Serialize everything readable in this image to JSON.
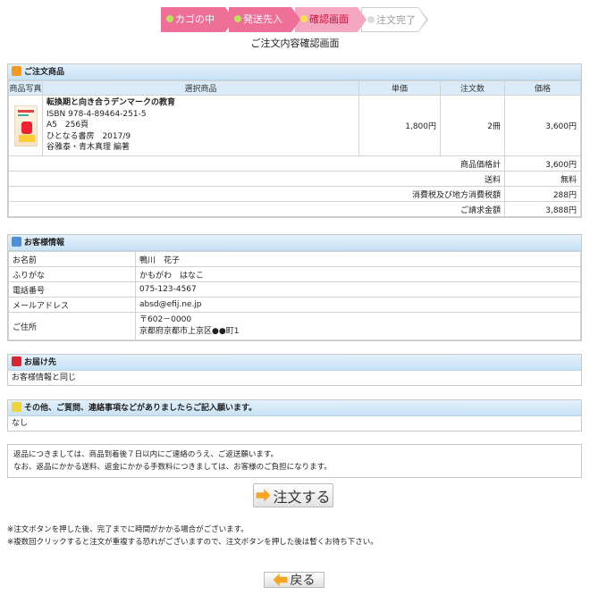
{
  "steps": [
    {
      "label": "カゴの中",
      "state": "done"
    },
    {
      "label": "発送先入力",
      "state": "done"
    },
    {
      "label": "確認画面",
      "state": "current"
    },
    {
      "label": "注文完了",
      "state": "todo"
    }
  ],
  "page_title": "ご注文内容確認画面",
  "order": {
    "section_title": "ご注文商品",
    "headers": {
      "photo": "商品写真",
      "item": "選択商品",
      "price": "単価",
      "qty": "注文数",
      "total": "価格"
    },
    "item": {
      "title": "転換期と向き合うデンマークの教育",
      "isbn": "ISBN 978-4-89464-251-5",
      "format": "A5　256頁",
      "publisher": "ひとなる書房　2017/9",
      "authors": "谷雅泰・青木真理 編著",
      "unit_price": "1,800円",
      "qty": "2冊",
      "price": "3,600円"
    },
    "summary": [
      {
        "label": "商品価格計",
        "value": "3,600円"
      },
      {
        "label": "送料",
        "value": "無料"
      },
      {
        "label": "消費税及び地方消費税額",
        "value": "288円"
      },
      {
        "label": "ご請求金額",
        "value": "3,888円"
      }
    ]
  },
  "customer": {
    "section_title": "お客様情報",
    "rows": [
      {
        "label": "お名前",
        "value": "鴨川　花子"
      },
      {
        "label": "ふりがな",
        "value": "かもがわ　はなこ"
      },
      {
        "label": "電話番号",
        "value": "075-123-4567"
      },
      {
        "label": "メールアドレス",
        "value": "absd@efij.ne.jp"
      }
    ],
    "address_label": "ご住所",
    "address_zip": "〒602－0000",
    "address_line": "京都府京都市上京区●●町1"
  },
  "delivery": {
    "section_title": "お届け先",
    "value": "お客様情報と同じ"
  },
  "other": {
    "section_title": "その他、ご質問、連絡事項などがありましたらご記入願います。",
    "value": "なし"
  },
  "returns_note": {
    "line1": "返品につきましては、商品到着後７日以内にご連絡のうえ、ご返送願います。",
    "line2": "なお、返品にかかる送料、返金にかかる手数料につきましては、お客様のご負担になります。"
  },
  "order_button": "注文する",
  "warnings": {
    "line1": "※注文ボタンを押した後、完了までに時間がかかる場合がございます。",
    "line2": "※複数回クリックすると注文が重複する恐れがございますので、注文ボタンを押した後は暫くお待ち下さい。"
  },
  "back_button": "戻る",
  "icons": {
    "cart_icon": "cart-icon",
    "person_icon": "person-icon",
    "mailbox_icon": "mailbox-icon",
    "speech_icon": "speech-bubble-icon"
  },
  "colors": {
    "step_done": "#ee6f98",
    "step_current": "#f4a7c0",
    "section_head": "#c8e2f6",
    "button_arrow": "#f6a623"
  }
}
